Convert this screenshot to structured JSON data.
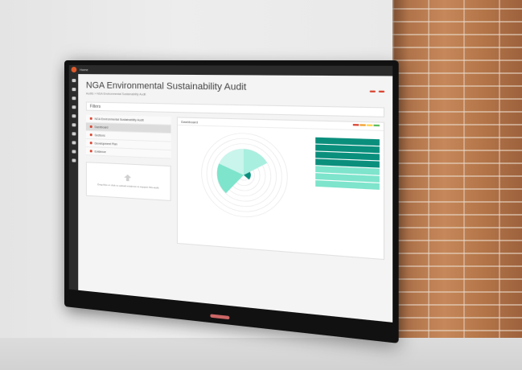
{
  "app": {
    "breadcrumb_home": "Home",
    "title": "NGA Environmental Sustainability Audit",
    "breadcrumb": "Audits > NGA Environmental Sustainability Audit"
  },
  "filters": {
    "label": "Filters"
  },
  "left_panel": {
    "items": [
      {
        "label": "NGA Environmental Sustainability Audit"
      },
      {
        "label": "Dashboard"
      },
      {
        "label": "Sections"
      },
      {
        "label": "Development Plan"
      },
      {
        "label": "Evidence"
      }
    ],
    "upload_text": "Drag files or click to upload evidence to support this audit"
  },
  "dashboard": {
    "title": "Dashboard"
  },
  "colors": {
    "accent": "#d9432f",
    "teal_dark": "#0b8f7d",
    "teal_light": "#7ee4cc",
    "sidebar": "#2b2b2b"
  }
}
